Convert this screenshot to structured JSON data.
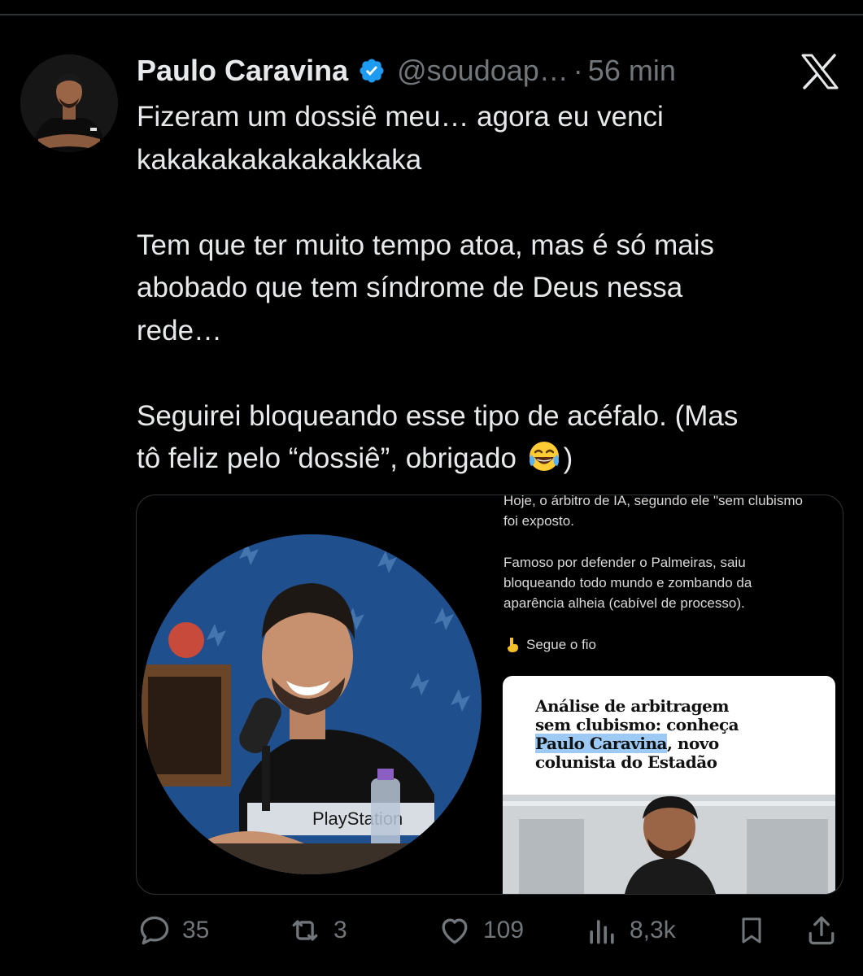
{
  "tweet": {
    "author": {
      "name": "Paulo Caravina",
      "handle": "@soudoap…",
      "verified": true
    },
    "separator": "·",
    "time": "56 min",
    "text_lines": [
      "Fizeram um dossiê meu… agora eu venci",
      "kakakakakakakakkaka",
      "",
      "Tem que ter muito tempo atoa, mas é só mais",
      "abobado que tem síndrome de Deus nessa",
      "rede…",
      "",
      "Seguirei bloqueando esse tipo de acéfalo. (Mas",
      "tô feliz pelo “dossiê”, obrigado",
      ")"
    ],
    "emoji": "face-with-tears-of-joy"
  },
  "media": {
    "screenshot_lines": [
      "Hoje, o árbitro de IA, segundo ele \"sem clubismo",
      "foi exposto.",
      "Famoso por defender o Palmeiras, saiu",
      "bloqueando todo mundo e zombando da",
      "aparência alheia (cabível de processo).",
      "Segue o fio"
    ],
    "pointing_emoji": "backhand-index-pointing-down",
    "shirt_text": "PlayStation",
    "article": {
      "headline_1": "Análise de arbitragem",
      "headline_2": "sem clubismo: conheça",
      "headline_3a": "Paulo Caravina",
      "headline_3b": ", novo",
      "headline_4": "colunista do Estadão",
      "highlight_color": "#9ccaf5"
    }
  },
  "actions": {
    "replies": "35",
    "retweets": "3",
    "likes": "109",
    "views": "8,3k"
  },
  "colors": {
    "background": "#000000",
    "text": "#e7e9ea",
    "muted": "#71767b",
    "verified_blue": "#1d9bf0",
    "border": "#2f3336"
  }
}
